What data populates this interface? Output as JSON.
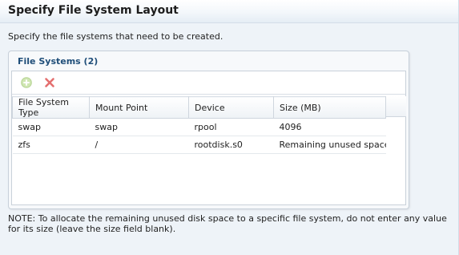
{
  "page": {
    "title": "Specify File System Layout",
    "description": "Specify the file systems that need to be created."
  },
  "panel": {
    "title": "File Systems (2)",
    "toolbar": {
      "add_icon": "add-icon",
      "delete_icon": "delete-icon"
    },
    "table": {
      "columns": [
        "File System Type",
        "Mount Point",
        "Device",
        "Size (MB)"
      ],
      "rows": [
        [
          "swap",
          "swap",
          "rpool",
          "4096"
        ],
        [
          "zfs",
          "/",
          "rootdisk.s0",
          "Remaining unused space"
        ]
      ]
    }
  },
  "note": "NOTE: To allocate the remaining unused disk space to a specific file system, do not enter any value for its size (leave the size field blank).",
  "colors": {
    "panel_title": "#1f4e79",
    "add_icon": "#8cc63f",
    "delete_icon": "#e05a5a"
  }
}
